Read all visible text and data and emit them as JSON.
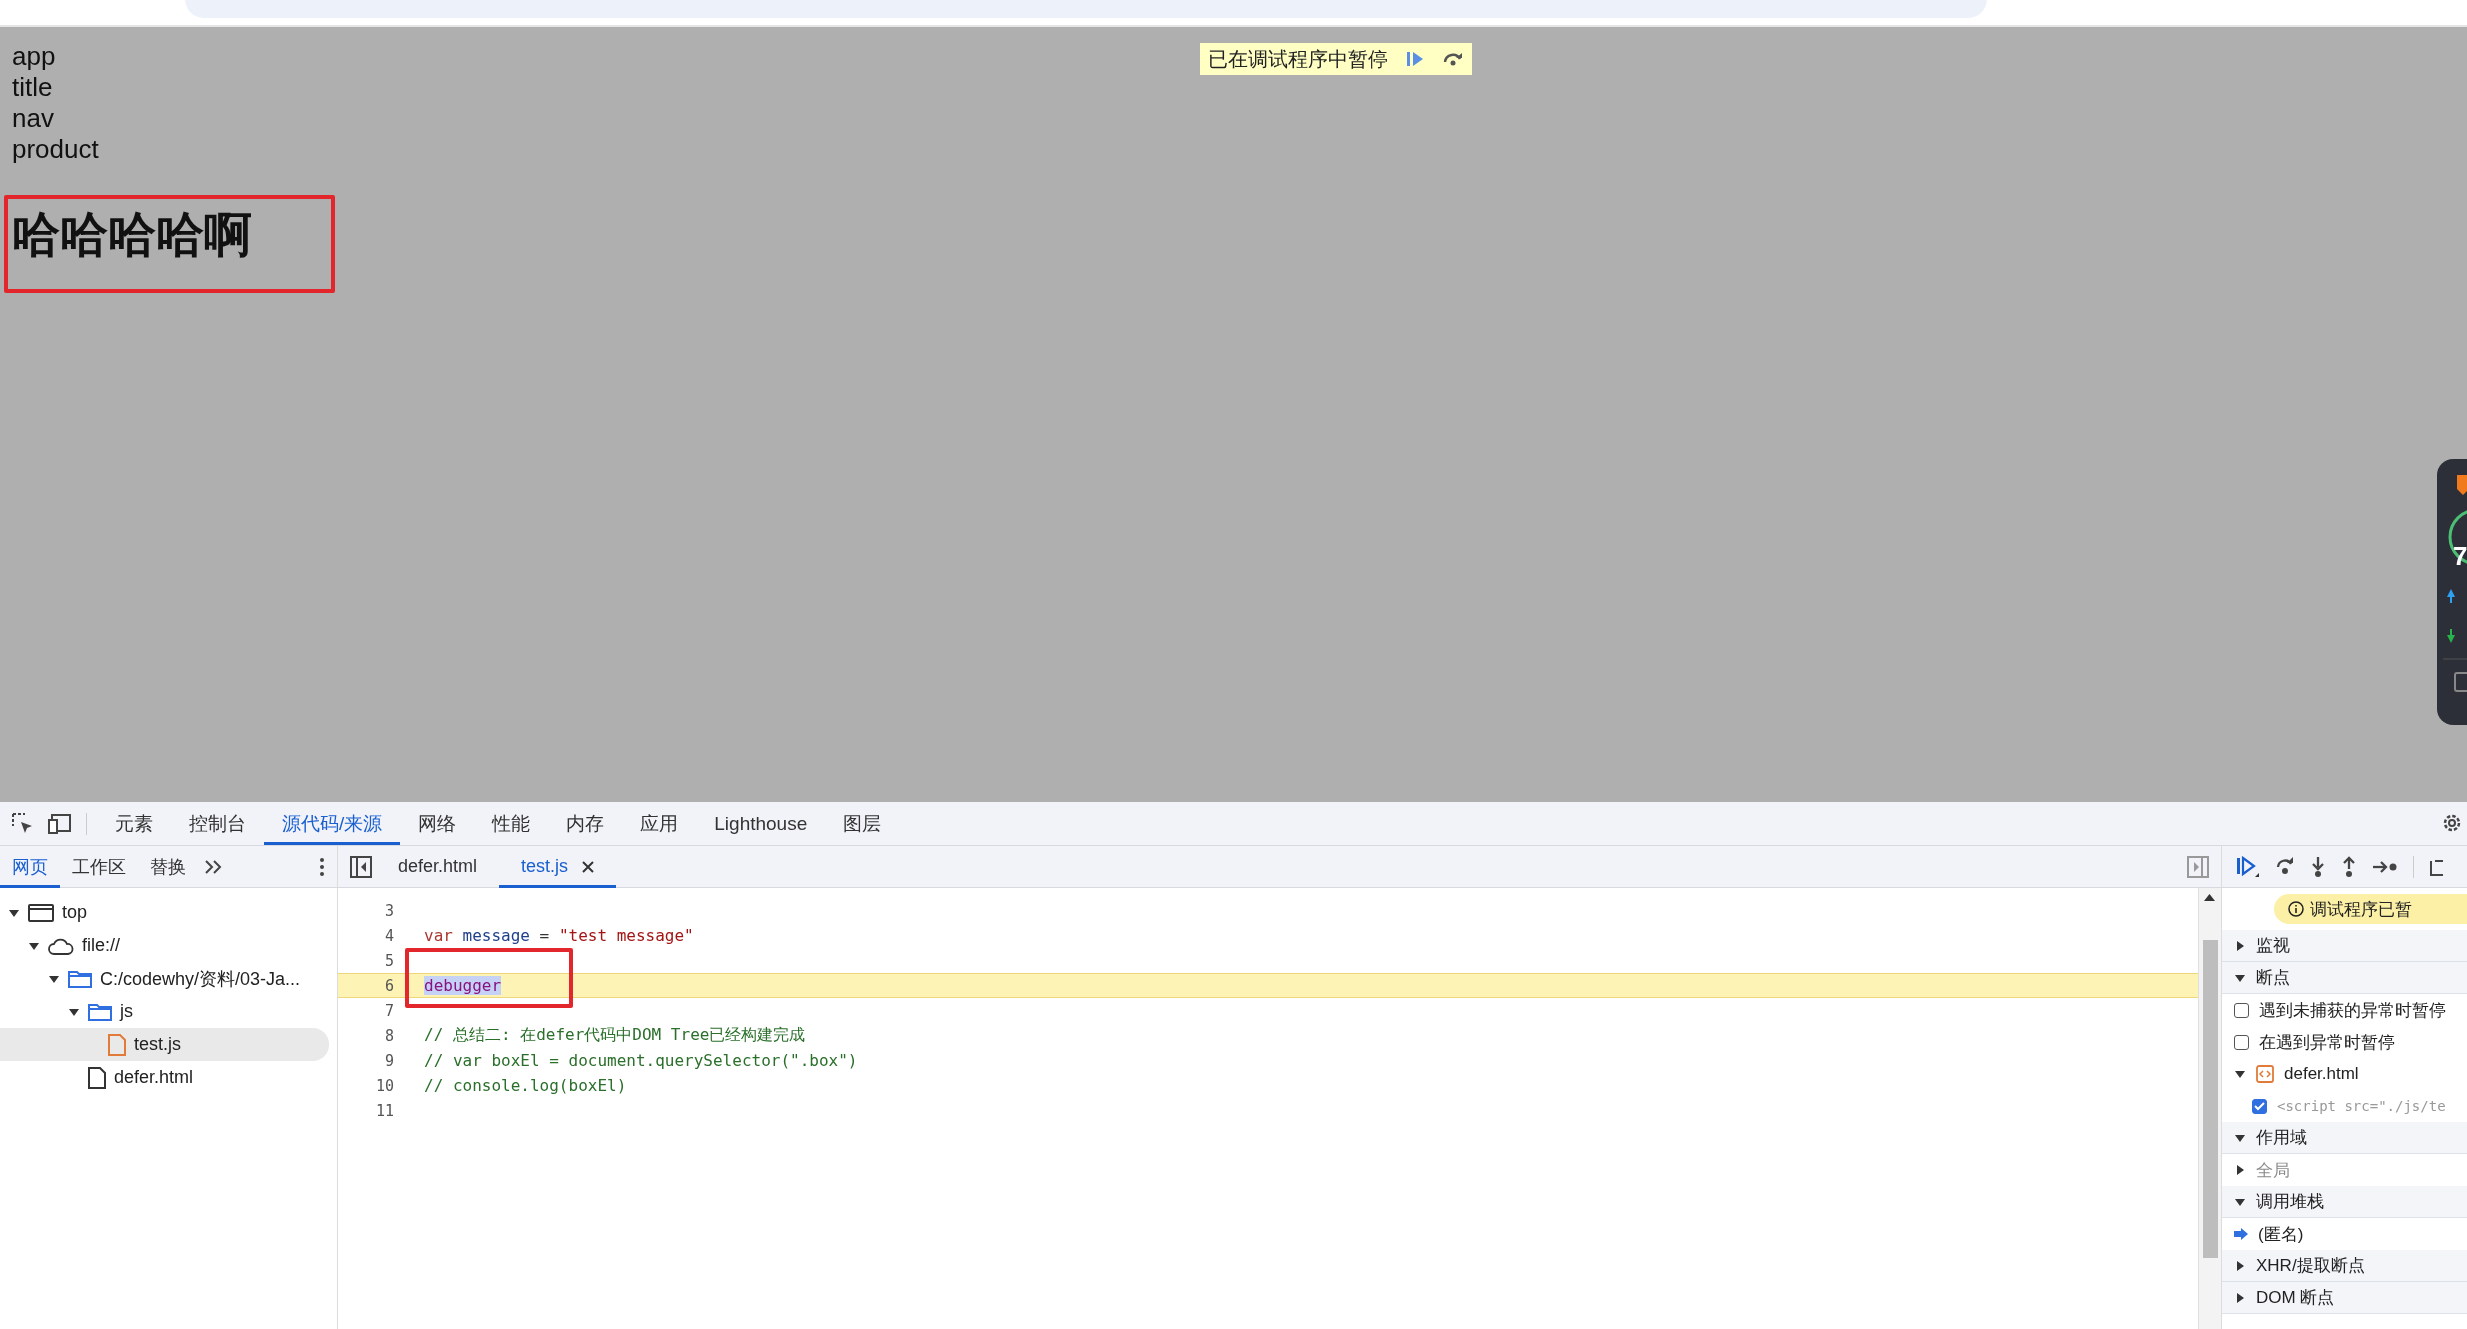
{
  "page": {
    "lines": [
      "app",
      "title",
      "nav",
      "product"
    ],
    "heading": "哈哈哈哈啊"
  },
  "paused_overlay": {
    "label": "已在调试程序中暂停"
  },
  "floating_widget": {
    "score": "7"
  },
  "devtools": {
    "main_tabs": [
      {
        "label": "元素",
        "selected": false
      },
      {
        "label": "控制台",
        "selected": false
      },
      {
        "label": "源代码/来源",
        "selected": true
      },
      {
        "label": "网络",
        "selected": false
      },
      {
        "label": "性能",
        "selected": false
      },
      {
        "label": "内存",
        "selected": false
      },
      {
        "label": "应用",
        "selected": false
      },
      {
        "label": "Lighthouse",
        "selected": false
      },
      {
        "label": "图层",
        "selected": false
      }
    ],
    "navigator_tabs": [
      {
        "label": "网页",
        "selected": true
      },
      {
        "label": "工作区",
        "selected": false
      },
      {
        "label": "替换",
        "selected": false
      }
    ],
    "file_tree": [
      {
        "label": "top",
        "kind": "frame",
        "expanded": true,
        "selected": false,
        "children": [
          {
            "label": "file://",
            "kind": "cloud",
            "expanded": true,
            "selected": false,
            "children": [
              {
                "label": "C:/codewhy/资料/03-Ja...",
                "kind": "folder",
                "expanded": true,
                "selected": false,
                "children": [
                  {
                    "label": "js",
                    "kind": "folder",
                    "expanded": true,
                    "selected": false,
                    "children": [
                      {
                        "label": "test.js",
                        "kind": "script",
                        "selected": true
                      }
                    ]
                  },
                  {
                    "label": "defer.html",
                    "kind": "document",
                    "selected": false
                  }
                ]
              }
            ]
          }
        ]
      }
    ],
    "editor_tabs": [
      {
        "label": "defer.html",
        "selected": false,
        "closable": false
      },
      {
        "label": "test.js",
        "selected": true,
        "closable": true
      }
    ],
    "code_lines": [
      {
        "number": "3",
        "paused": false
      },
      {
        "number": "4",
        "paused": false,
        "tokens": [
          {
            "kind": "keyword",
            "text": "var "
          },
          {
            "kind": "variable",
            "text": "message"
          },
          {
            "kind": "plain",
            "text": " = "
          },
          {
            "kind": "string",
            "text": "\"test message\""
          }
        ]
      },
      {
        "number": "5",
        "paused": false
      },
      {
        "number": "6",
        "paused": true,
        "tokens": [
          {
            "kind": "selected-keyword",
            "text": "debugger"
          }
        ]
      },
      {
        "number": "7",
        "paused": false
      },
      {
        "number": "8",
        "paused": false,
        "tokens": [
          {
            "kind": "comment",
            "text": "// 总结二: 在defer代码中DOM Tree已经构建完成"
          }
        ]
      },
      {
        "number": "9",
        "paused": false,
        "tokens": [
          {
            "kind": "comment",
            "text": "// var boxEl = document.querySelector(\".box\")"
          }
        ]
      },
      {
        "number": "10",
        "paused": false,
        "tokens": [
          {
            "kind": "comment",
            "text": "// console.log(boxEl)"
          }
        ]
      },
      {
        "number": "11",
        "paused": false
      }
    ],
    "debugger_banner": "调试程序已暂",
    "debugger_rows": [
      {
        "kind": "section",
        "label": "监视",
        "expanded": false
      },
      {
        "kind": "section",
        "label": "断点",
        "expanded": true
      },
      {
        "kind": "checkbox",
        "label": "遇到未捕获的异常时暂停",
        "checked": false
      },
      {
        "kind": "checkbox",
        "label": "在遇到异常时暂停",
        "checked": false
      },
      {
        "kind": "file",
        "label": "defer.html",
        "expanded": true
      },
      {
        "kind": "breakpoint",
        "label": "<script src=\"./js/te",
        "checked": true
      },
      {
        "kind": "section",
        "label": "作用域",
        "expanded": true
      },
      {
        "kind": "scope",
        "label": "全局",
        "expanded": false
      },
      {
        "kind": "section",
        "label": "调用堆栈",
        "expanded": true
      },
      {
        "kind": "frame",
        "label": "(匿名)",
        "current": true
      },
      {
        "kind": "section",
        "label": "XHR/提取断点",
        "expanded": false
      },
      {
        "kind": "section",
        "label": "DOM 断点",
        "expanded": false
      }
    ]
  }
}
